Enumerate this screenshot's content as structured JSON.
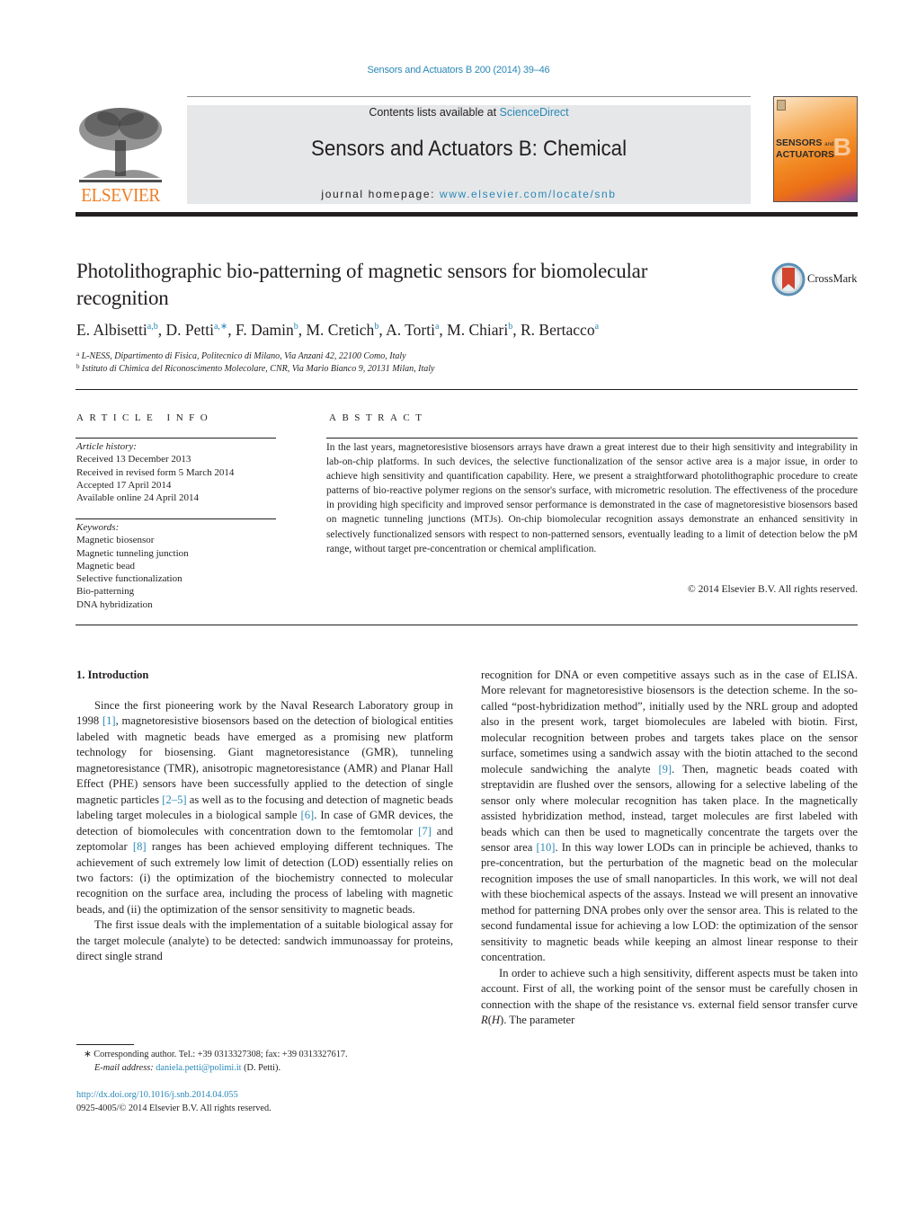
{
  "header": {
    "journal_ref": "Sensors and Actuators B 200 (2014) 39–46",
    "contents_prefix": "Contents lists available at ",
    "contents_link": "ScienceDirect",
    "journal_title": "Sensors and Actuators B: Chemical",
    "homepage_prefix": "journal homepage: ",
    "homepage_link": "www.elsevier.com/locate/snb",
    "publisher_logo": "ELSEVIER",
    "cover": {
      "title_line1": "SENSORS",
      "title_and": "and",
      "title_line2": "ACTUATORS",
      "letter": "B"
    },
    "colors": {
      "link": "#2a88b8",
      "elsevier_orange": "#f07e25"
    }
  },
  "article": {
    "title": "Photolithographic bio-patterning of magnetic sensors for biomolecular recognition",
    "crossmark_label": "CrossMark",
    "authors": [
      {
        "name": "E. Albisetti",
        "sup": "a,b"
      },
      {
        "name": "D. Petti",
        "sup": "a,∗"
      },
      {
        "name": "F. Damin",
        "sup": "b"
      },
      {
        "name": "M. Cretich",
        "sup": "b"
      },
      {
        "name": "A. Torti",
        "sup": "a"
      },
      {
        "name": "M. Chiari",
        "sup": "b"
      },
      {
        "name": "R. Bertacco",
        "sup": "a"
      }
    ],
    "affiliations": [
      {
        "mark": "a",
        "text": "L-NESS, Dipartimento di Fisica, Politecnico di Milano, Via Anzani 42, 22100 Como, Italy"
      },
      {
        "mark": "b",
        "text": "Istituto di Chimica del Riconoscimento Molecolare, CNR, Via Mario Bianco 9, 20131 Milan, Italy"
      }
    ]
  },
  "article_info": {
    "heading": "ARTICLE INFO",
    "history_label": "Article history:",
    "history": [
      "Received 13 December 2013",
      "Received in revised form 5 March 2014",
      "Accepted 17 April 2014",
      "Available online 24 April 2014"
    ],
    "keywords_label": "Keywords:",
    "keywords": [
      "Magnetic biosensor",
      "Magnetic tunneling junction",
      "Magnetic bead",
      "Selective functionalization",
      "Bio-patterning",
      "DNA hybridization"
    ]
  },
  "abstract": {
    "heading": "ABSTRACT",
    "text": "In the last years, magnetoresistive biosensors arrays have drawn a great interest due to their high sensitivity and integrability in lab-on-chip platforms. In such devices, the selective functionalization of the sensor active area is a major issue, in order to achieve high sensitivity and quantification capability. Here, we present a straightforward photolithographic procedure to create patterns of bio-reactive polymer regions on the sensor's surface, with micrometric resolution. The effectiveness of the procedure in providing high specificity and improved sensor performance is demonstrated in the case of magnetoresistive biosensors based on magnetic tunneling junctions (MTJs). On-chip biomolecular recognition assays demonstrate an enhanced sensitivity in selectively functionalized sensors with respect to non-patterned sensors, eventually leading to a limit of detection below the pM range, without target pre-concentration or chemical amplification.",
    "copyright": "© 2014 Elsevier B.V. All rights reserved."
  },
  "introduction": {
    "heading": "1.  Introduction",
    "p1": {
      "a": "Since the first pioneering work by the Naval Research Laboratory group in 1998 ",
      "c1": "[1]",
      "b": ", magnetoresistive biosensors based on the detection of biological entities labeled with magnetic beads have emerged as a promising new platform technology for biosensing. Giant magnetoresistance (GMR), tunneling magnetoresistance (TMR), anisotropic magnetoresistance (AMR) and Planar Hall Effect (PHE) sensors have been successfully applied to the detection of single magnetic particles ",
      "c2": "[2–5]",
      "c": " as well as to the focusing and detection of magnetic beads labeling target molecules in a biological sample ",
      "c3": "[6]",
      "d": ". In case of GMR devices, the detection of biomolecules with concentration down to the femtomolar ",
      "c4": "[7]",
      "e": " and zeptomolar ",
      "c5": "[8]",
      "f": " ranges has been achieved employing different techniques. The achievement of such extremely low limit of detection (LOD) essentially relies on two factors: (i) the optimization of the biochemistry connected to molecular recognition on the surface area, including the process of labeling with magnetic beads, and (ii) the optimization of the sensor sensitivity to magnetic beads."
    },
    "p2_left": "The first issue deals with the implementation of a suitable biological assay for the target molecule (analyte) to be detected: sandwich immunoassay for proteins, direct single strand",
    "p2_right": {
      "a": "recognition for DNA or even competitive assays such as in the case of ELISA. More relevant for magnetoresistive biosensors is the detection scheme. In the so-called “post-hybridization method”, initially used by the NRL group and adopted also in the present work, target biomolecules are labeled with biotin. First, molecular recognition between probes and targets takes place on the sensor surface, sometimes using a sandwich assay with the biotin attached to the second molecule sandwiching the analyte ",
      "c1": "[9]",
      "b": ". Then, magnetic beads coated with streptavidin are flushed over the sensors, allowing for a selective labeling of the sensor only where molecular recognition has taken place. In the magnetically assisted hybridization method, instead, target molecules are first labeled with beads which can then be used to magnetically concentrate the targets over the sensor area ",
      "c2": "[10]",
      "c": ". In this way lower LODs can in principle be achieved, thanks to pre-concentration, but the perturbation of the magnetic bead on the molecular recognition imposes the use of small nanoparticles. In this work, we will not deal with these biochemical aspects of the assays. Instead we will present an innovative method for patterning DNA probes only over the sensor area. This is related to the second fundamental issue for achieving a low LOD: the optimization of the sensor sensitivity to magnetic beads while keeping an almost linear response to their concentration."
    },
    "p3": {
      "a": "In order to achieve such a high sensitivity, different aspects must be taken into account. First of all, the working point of the sensor must be carefully chosen in connection with the shape of the resistance vs. external field sensor transfer curve ",
      "r": "R",
      "paren_open": "(",
      "h": "H",
      "b": "). The parameter"
    }
  },
  "footnote": {
    "mark": "∗",
    "corresponding": " Corresponding author. Tel.: +39 0313327308; fax: +39 0313327617.",
    "email_label": "E-mail address: ",
    "email": "daniela.petti@polimi.it",
    "email_suffix": " (D. Petti).",
    "doi": "http://dx.doi.org/10.1016/j.snb.2014.04.055",
    "issn": "0925-4005/© 2014 Elsevier B.V. All rights reserved."
  }
}
